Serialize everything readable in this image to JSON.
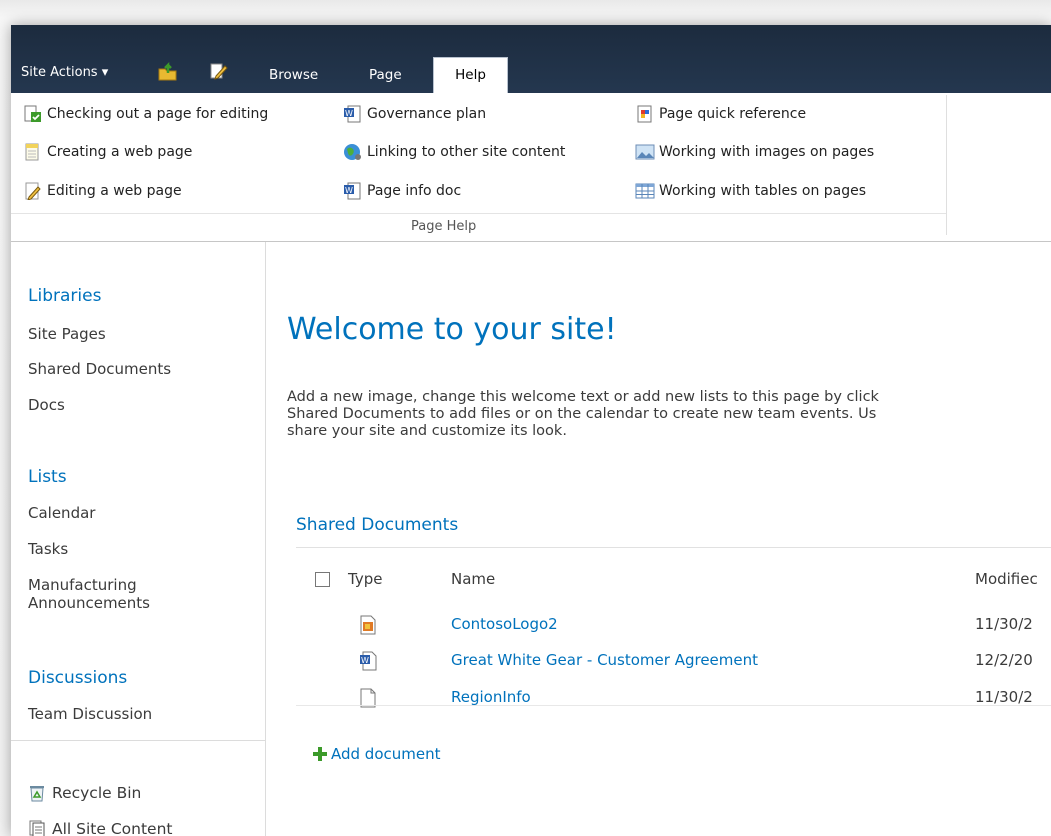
{
  "topbar": {
    "site_actions_label": "Site Actions ▾",
    "tabs": [
      {
        "label": "Browse"
      },
      {
        "label": "Page"
      },
      {
        "label": "Help"
      }
    ]
  },
  "ribbon": {
    "group_label": "Page Help",
    "col1": [
      {
        "label": "Checking out a page for editing",
        "icon": "checkout-page-icon"
      },
      {
        "label": "Creating a web page",
        "icon": "new-page-icon"
      },
      {
        "label": "Editing a web page",
        "icon": "edit-page-icon"
      }
    ],
    "col2": [
      {
        "label": "Governance plan",
        "icon": "word-doc-icon"
      },
      {
        "label": "Linking to other site content",
        "icon": "globe-link-icon"
      },
      {
        "label": "Page info doc",
        "icon": "word-doc-icon"
      }
    ],
    "col3": [
      {
        "label": "Page quick reference",
        "icon": "reference-icon"
      },
      {
        "label": "Working with images on pages",
        "icon": "image-icon"
      },
      {
        "label": "Working with tables on pages",
        "icon": "table-icon"
      }
    ]
  },
  "nav": {
    "libraries": {
      "heading": "Libraries",
      "items": [
        "Site Pages",
        "Shared Documents",
        "Docs"
      ]
    },
    "lists": {
      "heading": "Lists",
      "items": [
        "Calendar",
        "Tasks",
        "Manufacturing\nAnnouncements"
      ]
    },
    "discussions": {
      "heading": "Discussions",
      "items": [
        "Team Discussion"
      ]
    },
    "recycle_bin": "Recycle Bin",
    "all_site_content": "All Site Content"
  },
  "main": {
    "welcome_title": "Welcome to your site!",
    "intro_text": "Add a new image, change this welcome text or add new lists to this page by click\nShared Documents to add files or on the calendar to create new team events. Us\nshare your site and customize its look.",
    "shared_docs": {
      "title": "Shared Documents",
      "columns": {
        "type": "Type",
        "name": "Name",
        "modified": "Modifiec"
      },
      "rows": [
        {
          "type_icon": "image-file-icon",
          "name": "ContosoLogo2",
          "modified": "11/30/2"
        },
        {
          "type_icon": "word-file-icon",
          "name": "Great White Gear - Customer Agreement",
          "modified": "12/2/20"
        },
        {
          "type_icon": "generic-file-icon",
          "name": "RegionInfo",
          "modified": "11/30/2"
        }
      ],
      "add_label": "Add document"
    }
  },
  "colors": {
    "accent": "#0072bc",
    "topbar": "#24364d",
    "text": "#3b3b3b"
  }
}
